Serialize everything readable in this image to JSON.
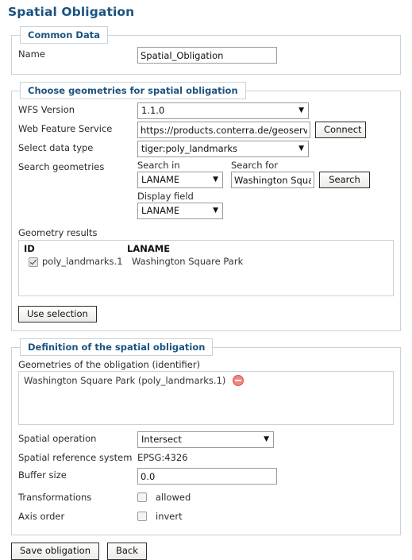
{
  "page_title": "Spatial Obligation",
  "common_data": {
    "legend": "Common Data",
    "name_label": "Name",
    "name_value": "Spatial_Obligation"
  },
  "choose_geometries": {
    "legend": "Choose geometries for spatial obligation",
    "wfs_version_label": "WFS Version",
    "wfs_version_value": "1.1.0",
    "web_feature_service_label": "Web Feature Service",
    "web_feature_service_value": "https://products.conterra.de/geoserver/ows",
    "connect_button": "Connect",
    "select_data_type_label": "Select data type",
    "select_data_type_value": "tiger:poly_landmarks",
    "search_geometries_label": "Search geometries",
    "search_in_label": "Search in",
    "search_in_value": "LANAME",
    "search_for_label": "Search for",
    "search_for_value": "Washington Square Park",
    "search_button": "Search",
    "display_field_label": "Display field",
    "display_field_value": "LANAME",
    "geometry_results_label": "Geometry results",
    "results_columns": [
      "ID",
      "LANAME"
    ],
    "results_rows": [
      {
        "checked": true,
        "id": "poly_landmarks.1",
        "laname": "Washington Square Park"
      }
    ],
    "use_selection_button": "Use selection"
  },
  "definition": {
    "legend": "Definition of the spatial obligation",
    "geometries_label": "Geometries of the obligation (identifier)",
    "geometry_items": [
      {
        "text": "Washington Square Park (poly_landmarks.1)",
        "remove_icon": "remove-circle-icon"
      }
    ],
    "spatial_operation_label": "Spatial operation",
    "spatial_operation_value": "Intersect",
    "spatial_reference_label": "Spatial reference system",
    "spatial_reference_value": "EPSG:4326",
    "buffer_size_label": "Buffer size",
    "buffer_size_value": "0.0",
    "transformations_label": "Transformations",
    "transformations_option": "allowed",
    "transformations_checked": false,
    "axis_order_label": "Axis order",
    "axis_order_option": "invert",
    "axis_order_checked": false
  },
  "footer": {
    "save_button": "Save obligation",
    "back_button": "Back"
  },
  "colors": {
    "title_blue": "#1c5380",
    "panel_border": "#c8d2da",
    "remove_red": "#f0867c"
  }
}
